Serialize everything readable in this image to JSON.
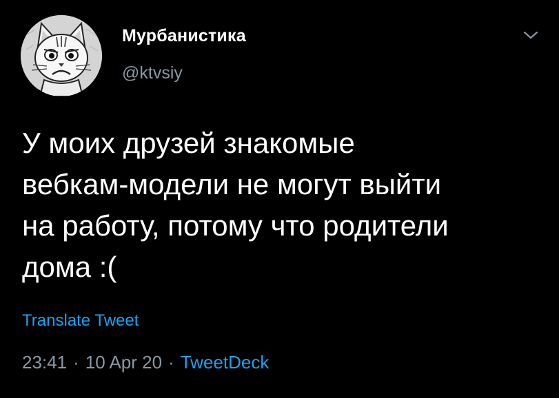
{
  "author": {
    "display_name": "Мурбанистика",
    "handle": "@ktvsiy",
    "avatar_icon": "grumpy-cat-avatar"
  },
  "tweet": {
    "text": "У моих друзей знакомые\nвебкам-модели не могут выйти\nна работу, потому что родители\nдома :(",
    "translate_label": "Translate Tweet"
  },
  "meta": {
    "time": "23:41",
    "date": "10 Apr 20",
    "separator": "·",
    "source": "TweetDeck"
  },
  "colors": {
    "background": "#000000",
    "text_primary": "#ffffff",
    "text_secondary": "#8899a6",
    "accent": "#1da1f2"
  },
  "icons": {
    "menu": "chevron-down-icon"
  }
}
